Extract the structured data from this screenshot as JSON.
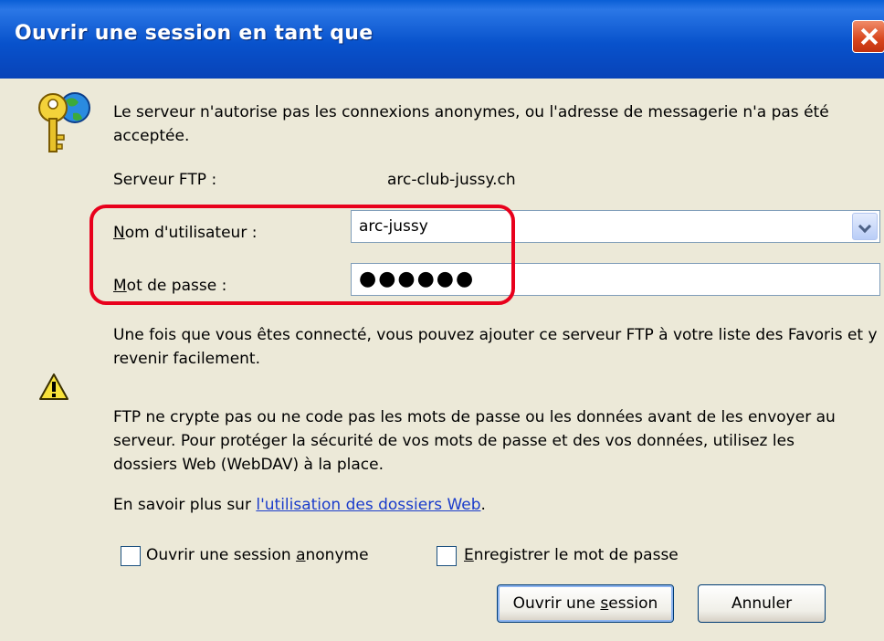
{
  "window": {
    "title": "Ouvrir une session en tant que"
  },
  "message": {
    "text": "Le serveur n'autorise pas les connexions anonymes, ou l'adresse de messagerie n'a pas été acceptée."
  },
  "server": {
    "label": "Serveur FTP :",
    "value": "arc-club-jussy.ch"
  },
  "username": {
    "label_accel": "N",
    "label_rest": "om d'utilisateur :",
    "value": "arc-jussy"
  },
  "password": {
    "label_accel": "M",
    "label_rest": "ot de passe :",
    "value": "●●●●●●"
  },
  "info": {
    "favorites_text": "Une fois que vous êtes connecté, vous pouvez ajouter ce serveur FTP à votre liste des Favoris et y revenir facilement.",
    "security_text": "FTP ne crypte pas ou ne code pas les mots de passe ou les données avant de les envoyer au serveur. Pour protéger la sécurité de vos mots de passe et des vos données, utilisez les dossiers Web (WebDAV) à la place.",
    "learn_more_prefix": "En savoir plus sur ",
    "learn_more_link": "l'utilisation des dossiers Web",
    "learn_more_suffix": "."
  },
  "checkboxes": {
    "anonymous_before": "Ouvrir une session ",
    "anonymous_accel": "a",
    "anonymous_after": "nonyme",
    "anonymous_checked": false,
    "save_accel": "E",
    "save_after": "nregistrer le mot de passe",
    "save_checked": false
  },
  "buttons": {
    "login_before": "Ouvrir une ",
    "login_accel": "s",
    "login_after": "ession",
    "cancel": "Annuler"
  },
  "colors": {
    "titlebar": "#0852cc",
    "dialog_bg": "#ece9d8",
    "highlight": "#e8001c",
    "link": "#1a3ccb"
  }
}
